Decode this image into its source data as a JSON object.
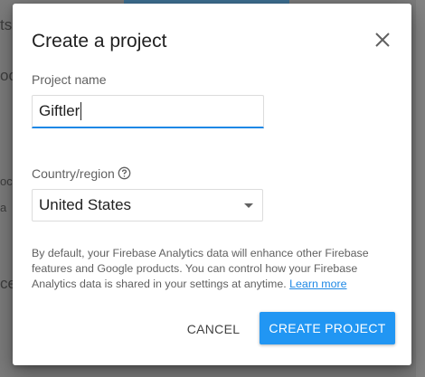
{
  "dialog": {
    "title": "Create a project",
    "project_name_label": "Project name",
    "project_name_value": "Giftler",
    "country_label": "Country/region",
    "country_value": "United States",
    "info_text": "By default, your Firebase Analytics data will enhance other Firebase features and Google products. You can control how your Firebase Analytics data is shared in your settings at anytime.",
    "learn_more": "Learn more",
    "cancel_label": "CANCEL",
    "create_label": "CREATE PROJECT"
  },
  "colors": {
    "accent": "#2196f3",
    "underline": "#1e88e5",
    "overlay": "#7b7b7b"
  },
  "background": {
    "fragments": [
      "ts",
      "oc",
      "oc",
      "a",
      "ce"
    ]
  },
  "icons": [
    "close-icon",
    "help-circle-icon",
    "dropdown-arrow-icon"
  ]
}
